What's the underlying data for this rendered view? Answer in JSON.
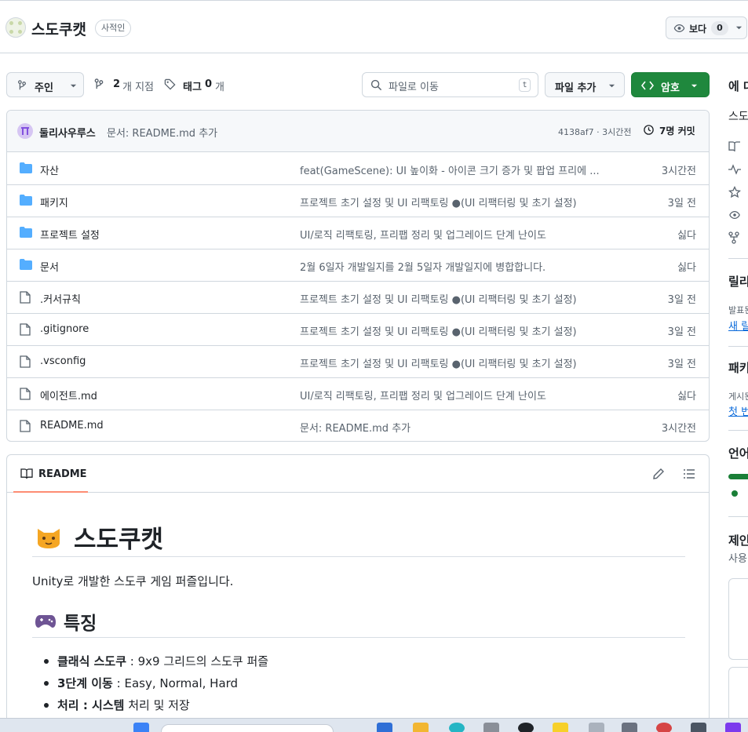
{
  "repo": {
    "name": "스도쿠캣",
    "visibility": "사적인",
    "watch_label": "보다",
    "watch_count": "0"
  },
  "toolbar": {
    "branch": "주인",
    "branch_count": "2",
    "branch_suffix": "개 지점",
    "tag_label": "태그",
    "tag_count": "0",
    "tag_suffix": "개",
    "search_placeholder": "파일로 이동",
    "search_key": "t",
    "add_file": "파일 추가",
    "code": "암호"
  },
  "commit": {
    "author": "둘리사우루스",
    "message": "문서: README.md 추가",
    "sha_time": "4138af7 · 3시간전",
    "commits": "7명 커밋"
  },
  "files": [
    {
      "type": "folder",
      "name": "자산",
      "message": "feat(GameScene): UI 높이화 - 아이콘 크기 증가 및 팝업 프리에 ...",
      "time": "3시간전"
    },
    {
      "type": "folder",
      "name": "패키지",
      "message": "프로젝트 초기 설정 및 UI 리팩토링 ●(UI 리팩터링 및 초기 설정)",
      "time": "3일 전"
    },
    {
      "type": "folder",
      "name": "프로젝트 설정",
      "message": "UI/로직 리팩토링, 프리팹 정리 및 업그레이드 단계 난이도",
      "time": "싫다"
    },
    {
      "type": "folder",
      "name": "문서",
      "message": "2월 6일자 개발일지를 2월 5일자 개발일지에 병합합니다.",
      "time": "싫다"
    },
    {
      "type": "file",
      "name": ".커서규칙",
      "message": "프로젝트 초기 설정 및 UI 리팩토링 ●(UI 리팩터링 및 초기 설정)",
      "time": "3일 전"
    },
    {
      "type": "file",
      "name": ".gitignore",
      "message": "프로젝트 초기 설정 및 UI 리팩토링 ●(UI 리팩터링 및 초기 설정)",
      "time": "3일 전"
    },
    {
      "type": "file",
      "name": ".vsconfig",
      "message": "프로젝트 초기 설정 및 UI 리팩토링 ●(UI 리팩터링 및 초기 설정)",
      "time": "3일 전"
    },
    {
      "type": "file",
      "name": "에이전트.md",
      "message": "UI/로직 리팩토링, 프리팹 정리 및 업그레이드 단계 난이도",
      "time": "싫다"
    },
    {
      "type": "file",
      "name": "README.md",
      "message": "문서: README.md 추가",
      "time": "3시간전"
    }
  ],
  "readme": {
    "tab": "README",
    "title_emoji": "cat-emoji",
    "title": "스도쿠캣",
    "intro": "Unity로 개발한 스도쿠 게임 퍼즐입니다.",
    "features_emoji": "game-controller-emoji",
    "features_heading": "특징",
    "features": [
      {
        "bold": "클래식 스도쿠",
        "rest": " : 9x9 그리드의 스도쿠 퍼즐"
      },
      {
        "bold": "3단계 이동",
        "rest": " : Easy, Normal, Hard"
      },
      {
        "bold": "처리 : 시스템",
        "rest": " 처리 및 저장"
      }
    ]
  },
  "sidebar": {
    "about": "에 대",
    "desc": "스도",
    "releases": "릴리",
    "releases_sub": "발표된",
    "releases_link": "새 릴",
    "packages": "패키",
    "packages_sub": "게시된",
    "packages_link": "첫 번",
    "languages": "언어",
    "suggest": "제인",
    "suggest_sub": "사용"
  },
  "colors": {
    "accent_green": "#1f883d",
    "folder_blue": "#54aeff",
    "link_blue": "#0969da",
    "tab_underline": "#fd8c73"
  }
}
